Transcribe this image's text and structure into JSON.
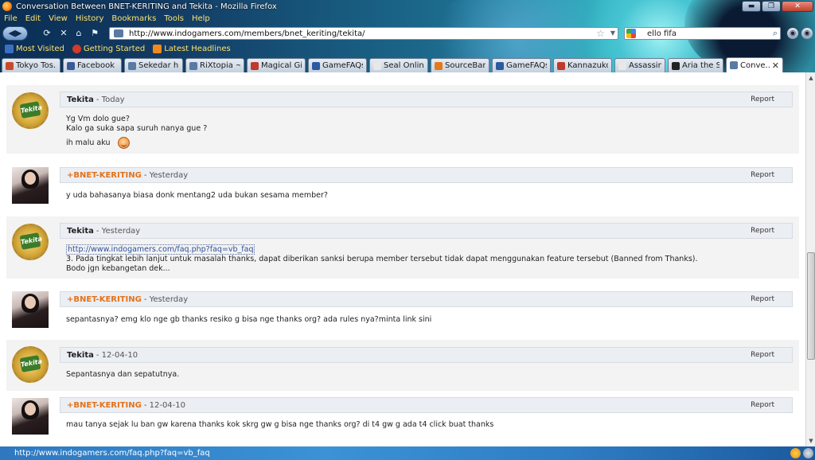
{
  "window": {
    "title": "Conversation Between BNET-KERITING and Tekita - Mozilla Firefox",
    "min_btn": "▬",
    "max_btn": "❐",
    "close_btn": "✕"
  },
  "menu": [
    "File",
    "Edit",
    "View",
    "History",
    "Bookmarks",
    "Tools",
    "Help"
  ],
  "nav": {
    "back_glyph": "◀▶",
    "url": "http://www.indogamers.com/members/bnet_keriting/tekita/",
    "search_text": "ello fifa",
    "star_glyph": "☆",
    "drop_glyph": "▼",
    "search_glyph": "⌕"
  },
  "bookmarks": [
    {
      "label": "Most Visited",
      "color": "#3a6fc4"
    },
    {
      "label": "Getting Started",
      "color": "#d23a2a"
    },
    {
      "label": "Latest Headlines",
      "color": "#f08a1c"
    }
  ],
  "tabs": [
    {
      "label": "Tokyo Tos...",
      "color": "#c94a2a"
    },
    {
      "label": "Facebook",
      "color": "#3b5998"
    },
    {
      "label": "Sekedar hi...",
      "color": "#5a7aa4"
    },
    {
      "label": "RiXtopia ~ ...",
      "color": "#5a7aa4"
    },
    {
      "label": "Magical Gi...",
      "color": "#c0392b"
    },
    {
      "label": "GameFAQs...",
      "color": "#2c5aa0"
    },
    {
      "label": "Seal Online...",
      "color": "#e8e8e8"
    },
    {
      "label": "SourceBans",
      "color": "#e07a1a"
    },
    {
      "label": "GameFAQs...",
      "color": "#2c5aa0"
    },
    {
      "label": "Kannazuko...",
      "color": "#c0392b"
    },
    {
      "label": "Assassin Cr...",
      "color": "#e8e8e8"
    },
    {
      "label": "Aria the Sc...",
      "color": "#222222"
    },
    {
      "label": "Conve...",
      "color": "#5a7aa4",
      "active": true
    }
  ],
  "messages": [
    {
      "author": "Tekita",
      "date": "- Today",
      "report": "Report",
      "avatar": "cap",
      "avatar_text": "Tekita",
      "orange": false,
      "lines": [
        "Yg Vm dolo gue?",
        "Kalo ga suka sapa suruh nanya gue ?",
        "ih malu aku"
      ]
    },
    {
      "author": "+BNET-KERITING",
      "date": "- Yesterday",
      "report": "Report",
      "avatar": "photo",
      "orange": true,
      "lines": [
        "y uda bahasanya biasa donk mentang2 uda bukan sesama member?"
      ]
    },
    {
      "author": "Tekita",
      "date": "- Yesterday",
      "report": "Report",
      "avatar": "cap",
      "avatar_text": "Tekita",
      "orange": false,
      "link": "http://www.indogamers.com/faq.php?faq=vb_faq",
      "lines": [
        "3. Pada tingkat lebih lanjut untuk masalah thanks, dapat diberikan sanksi berupa member tersebut tidak dapat menggunakan feature tersebut (Banned from Thanks).",
        "Bodo jgn kebangetan dek..."
      ]
    },
    {
      "author": "+BNET-KERITING",
      "date": "- Yesterday",
      "report": "Report",
      "avatar": "photo",
      "orange": true,
      "lines": [
        "sepantasnya? emg klo nge gb thanks resiko g bisa nge thanks org? ada rules nya?minta link sini"
      ]
    },
    {
      "author": "Tekita",
      "date": "- 12-04-10",
      "report": "Report",
      "avatar": "cap",
      "avatar_text": "Tekita",
      "orange": false,
      "lines": [
        "Sepantasnya dan sepatutnya."
      ]
    },
    {
      "author": "+BNET-KERITING",
      "date": "- 12-04-10",
      "report": "Report",
      "avatar": "photo",
      "orange": true,
      "lines": [
        "mau tanya sejak lu ban gw karena thanks kok skrg gw g bisa nge thanks org? di t4 gw g ada t4 click buat thanks"
      ]
    }
  ],
  "status": {
    "text": "http://www.indogamers.com/faq.php?faq=vb_faq"
  }
}
